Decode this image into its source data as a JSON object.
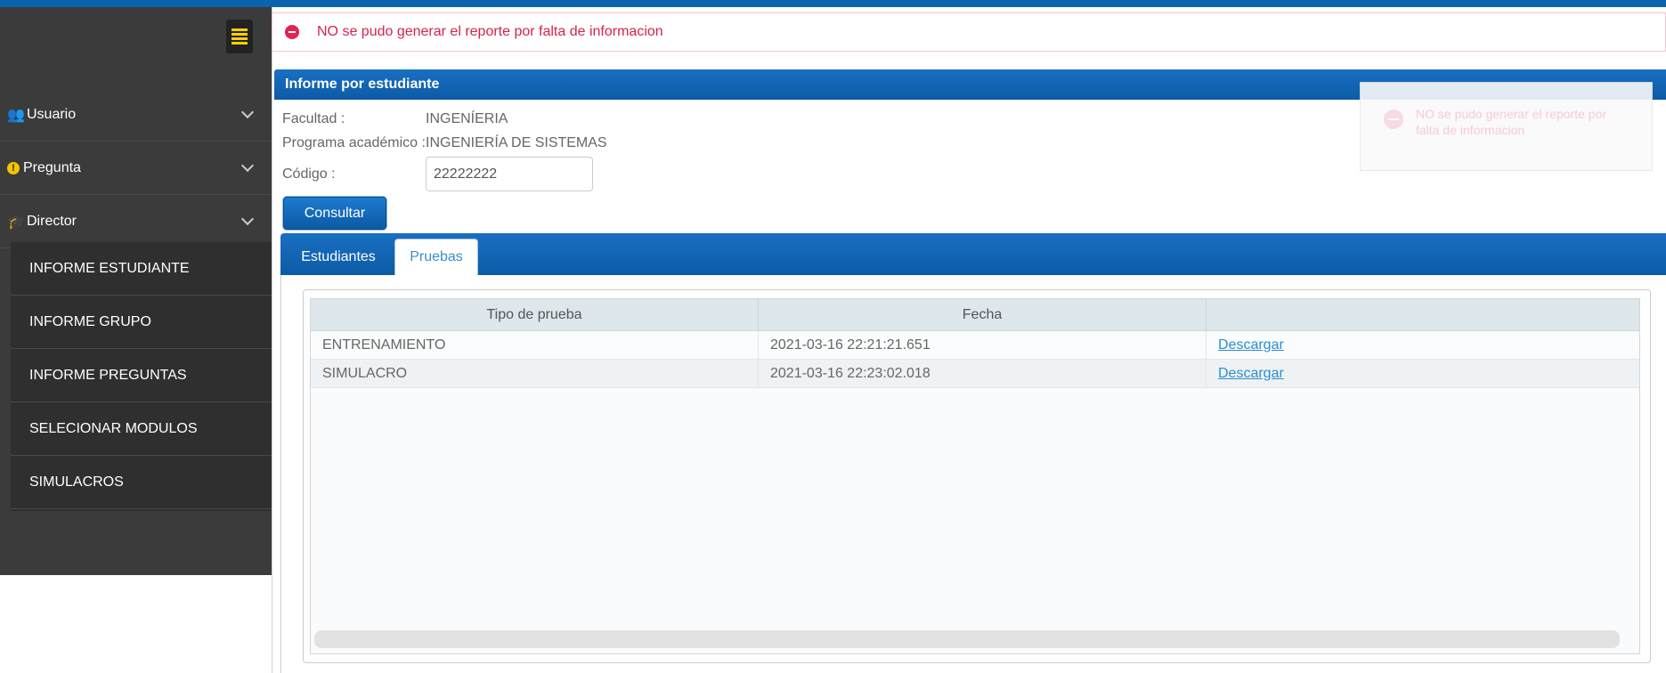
{
  "sidebar": {
    "menu": [
      {
        "label": "Usuario",
        "icon": "users-icon"
      },
      {
        "label": "Pregunta",
        "icon": "exclamation-circle-icon"
      },
      {
        "label": "Director",
        "icon": "graduation-cap-icon"
      }
    ],
    "submenu": [
      {
        "label": "INFORME ESTUDIANTE"
      },
      {
        "label": "INFORME GRUPO"
      },
      {
        "label": "INFORME PREGUNTAS"
      },
      {
        "label": "SELECIONAR MODULOS"
      },
      {
        "label": "SIMULACROS"
      }
    ]
  },
  "alert": {
    "message": "NO se pudo generar el reporte por falta de informacion"
  },
  "panel": {
    "title": "Informe por estudiante"
  },
  "form": {
    "facultad_label": "Facultad :",
    "facultad_value": "INGENÍERIA",
    "programa_label": "Programa académico :",
    "programa_value": "INGENIERÍA DE SISTEMAS",
    "codigo_label": "Código :",
    "codigo_value": "22222222",
    "submit_label": "Consultar"
  },
  "toast": {
    "message": "NO se pudo generar el reporte por falta de informacion"
  },
  "tabs": [
    {
      "label": "Estudiantes",
      "active": false
    },
    {
      "label": "Pruebas",
      "active": true
    }
  ],
  "table": {
    "columns": [
      "Tipo de prueba",
      "Fecha",
      ""
    ],
    "rows": [
      {
        "tipo": "ENTRENAMIENTO",
        "fecha": "2021-03-16 22:21:21.651",
        "accion": "Descargar"
      },
      {
        "tipo": "SIMULACRO",
        "fecha": "2021-03-16 22:23:02.018",
        "accion": "Descargar"
      }
    ]
  },
  "colors": {
    "brand_blue": "#0b62ad",
    "sidebar_bg": "#3b3b3b",
    "accent_yellow": "#f5c400",
    "error_red": "#e0244f",
    "link_blue": "#2b8ed0"
  }
}
